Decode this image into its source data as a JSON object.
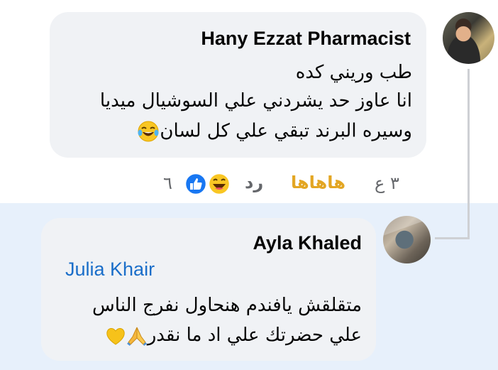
{
  "comment_1": {
    "author": "Hany Ezzat Pharmacist",
    "lines": [
      "طب وريني كده",
      "انا عاوز حد يشردني علي السوشيال ميديا",
      "وسيره  البرند تبقي علي كل لسان"
    ],
    "trailing_emoji": "laughing-tears-emoji",
    "actions": {
      "time_ago": "٣ ع",
      "haha": "هاهاها",
      "reply": "رد",
      "reaction_count": "٦",
      "reaction_icons": [
        "haha-emoji",
        "like-icon"
      ]
    }
  },
  "comment_2": {
    "author": "Ayla Khaled",
    "mention": "Julia Khair",
    "lines": [
      "متقلقش يافندم هنحاول نفرج الناس",
      "علي حضرتك علي اد ما نقدر"
    ],
    "trailing_emojis": [
      "folded-hands-emoji",
      "yellow-heart-emoji"
    ]
  },
  "colors": {
    "bubble": "#f0f2f5",
    "highlight_background": "#e7f0fb",
    "mention": "#1a6ec9",
    "haha_action": "#e3a623",
    "muted_text": "#65676b",
    "thread_line": "#ced0d4"
  }
}
